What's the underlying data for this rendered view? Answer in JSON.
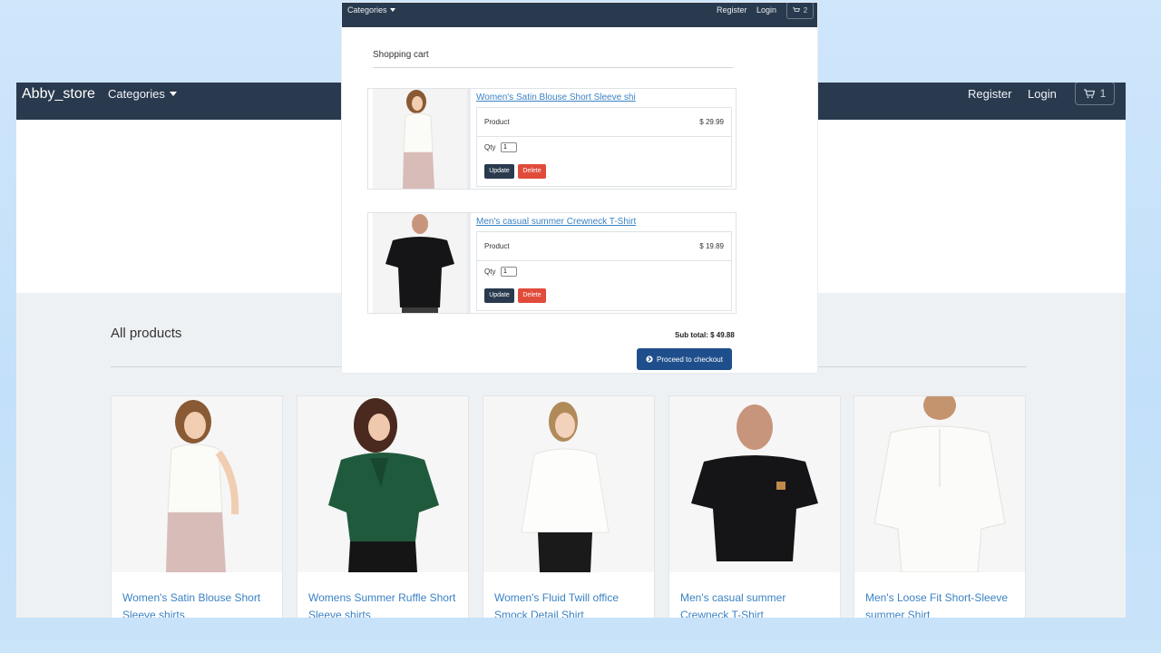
{
  "store": {
    "brand": "Abby_store",
    "nav": {
      "categories": "Categories",
      "register": "Register",
      "login": "Login",
      "cart_count": "1"
    },
    "section_title": "All products",
    "products": [
      {
        "title": "Women's Satin Blouse Short Sleeve shirts"
      },
      {
        "title": "Womens Summer Ruffle Short Sleeve shirts"
      },
      {
        "title": "Women's Fluid Twill office Smock Detail Shirt"
      },
      {
        "title": "Men's casual summer Crewneck T-Shirt"
      },
      {
        "title": "Men's Loose Fit Short-Sleeve summer Shirt"
      }
    ]
  },
  "cart_overlay": {
    "nav": {
      "categories": "Categories",
      "register": "Register",
      "login": "Login",
      "cart_count": "2"
    },
    "title": "Shopping cart",
    "items": [
      {
        "name": "Women's Satin Blouse Short Sleeve shi",
        "product_label": "Product",
        "price": "$ 29.99",
        "qty_label": "Qty",
        "qty": "1",
        "update": "Update",
        "delete": "Delete"
      },
      {
        "name": "Men's casual summer Crewneck T-Shirt",
        "product_label": "Product",
        "price": "$ 19.89",
        "qty_label": "Qty",
        "qty": "1",
        "update": "Update",
        "delete": "Delete"
      }
    ],
    "subtotal": "Sub total: $ 49.88",
    "checkout": "Proceed to checkout"
  },
  "colors": {
    "navbar": "#2a3a4e",
    "link": "#3b82c4",
    "delete": "#e04b3a",
    "checkout": "#1f4e8c"
  },
  "icons": [
    "cart-icon",
    "chevron-down-icon",
    "arrow-circle-right-icon"
  ]
}
